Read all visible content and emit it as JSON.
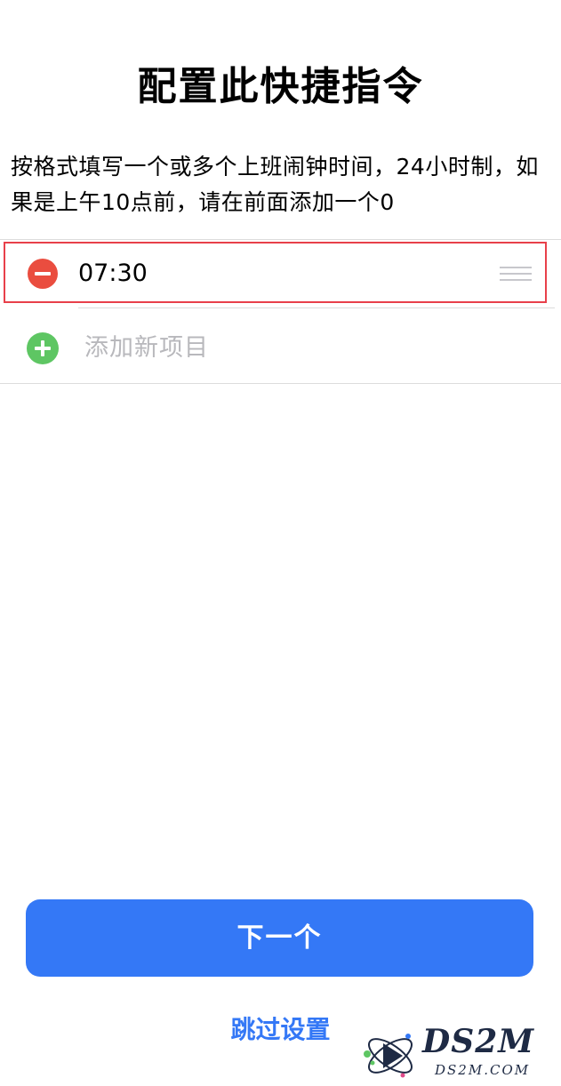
{
  "page": {
    "title": "配置此快捷指令",
    "instructions": "按格式填写一个或多个上班闹钟时间，24小时制，如果是上午10点前，请在前面添加一个0"
  },
  "list": {
    "items": [
      {
        "value": "07:30"
      }
    ],
    "add_placeholder": "添加新项目"
  },
  "footer": {
    "next_label": "下一个",
    "skip_label": "跳过设置"
  },
  "watermark": {
    "brand": "DS2M",
    "domain": "DS2M.COM"
  },
  "colors": {
    "accent": "#3478f6",
    "delete": "#ea4d3f",
    "add": "#5ec663",
    "highlight_border": "#e8404a"
  },
  "icons": {
    "delete": "minus-circle-icon",
    "add": "plus-circle-icon",
    "reorder": "drag-handle-icon"
  }
}
